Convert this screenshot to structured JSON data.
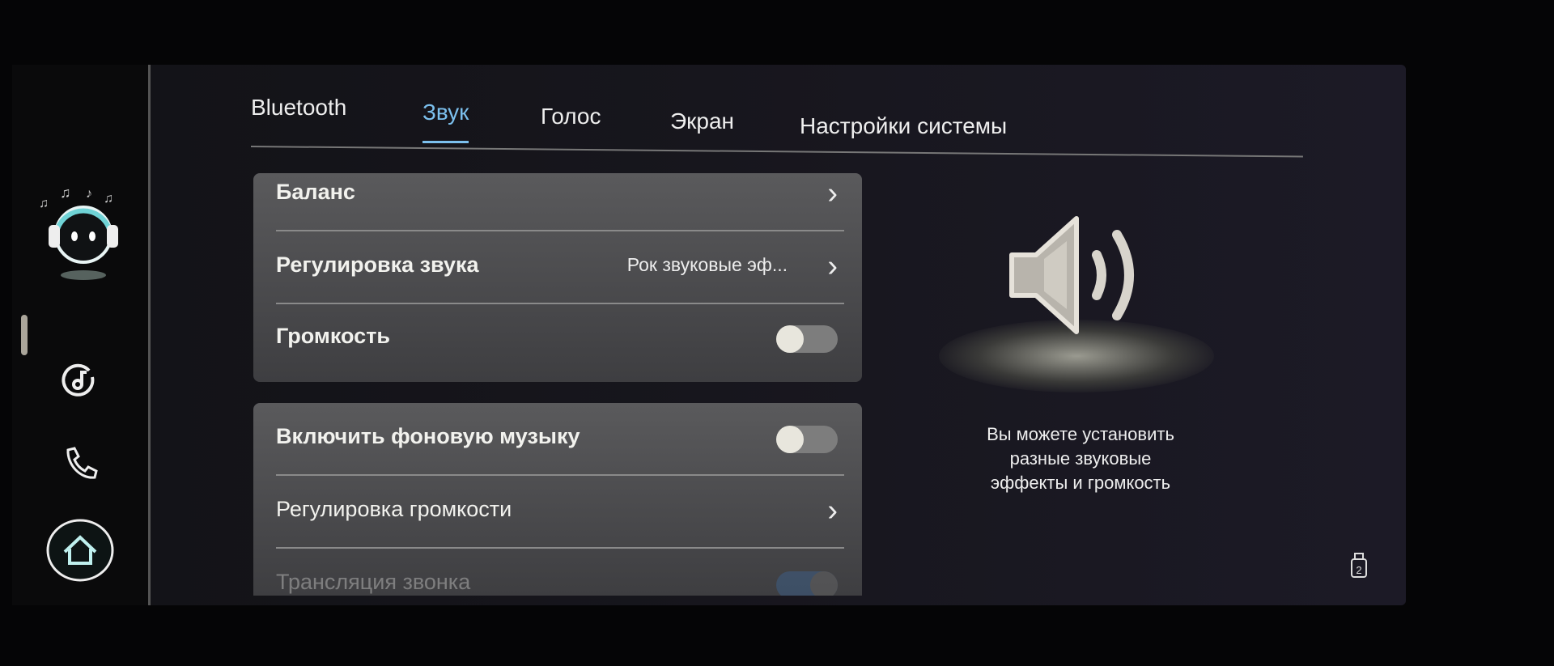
{
  "tabs": [
    {
      "label": "Bluetooth",
      "active": false
    },
    {
      "label": "Звук",
      "active": true
    },
    {
      "label": "Голос",
      "active": false
    },
    {
      "label": "Экран",
      "active": false
    },
    {
      "label": "Настройки системы",
      "active": false
    }
  ],
  "panel1": {
    "balance": {
      "label": "Баланс"
    },
    "sound_adjust": {
      "label": "Регулировка звука",
      "value": "Рок звуковые эф..."
    },
    "volume": {
      "label": "Громкость",
      "toggle_on": false
    }
  },
  "panel2": {
    "bg_music": {
      "label": "Включить фоновую музыку",
      "toggle_on": false
    },
    "volume_adjust": {
      "label": "Регулировка громкости"
    },
    "call_broadcast": {
      "label": "Трансляция звонка",
      "toggle_on": true
    }
  },
  "hint": {
    "line1": "Вы можете установить",
    "line2": "разные звуковые",
    "line3": "эффекты и громкость"
  },
  "sidebar": {
    "icons": [
      "assistant-avatar",
      "music-icon",
      "phone-icon",
      "home-icon"
    ]
  },
  "colors": {
    "accent": "#7cc0ee",
    "toggle_on": "#3c6ea8"
  }
}
